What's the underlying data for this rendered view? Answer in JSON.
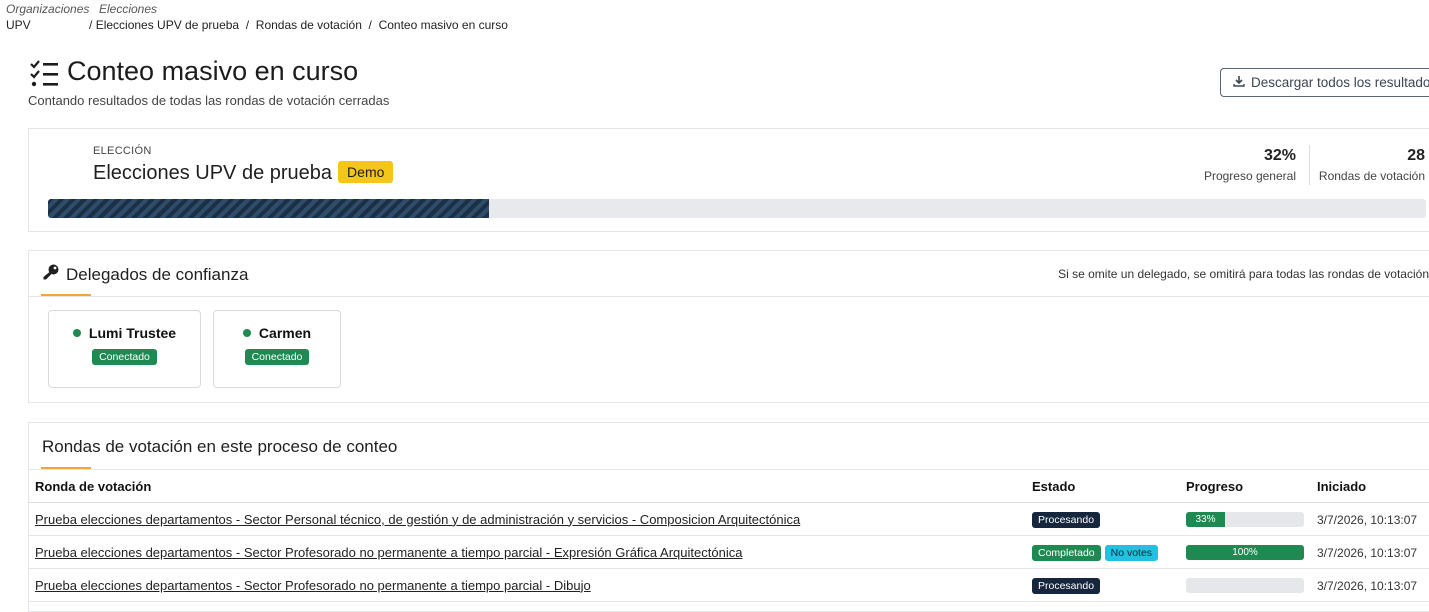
{
  "breadcrumb": {
    "org_category": "Organizaciones",
    "org_value": "UPV",
    "elections_category": "Elecciones",
    "election": "Elecciones UPV de prueba",
    "rounds": "Rondas de votación",
    "current": "Conteo masivo en curso",
    "separator": "/"
  },
  "header": {
    "icon": "checklist-icon",
    "title": "Conteo masivo en curso",
    "subtitle": "Contando resultados de todas las rondas de votación cerradas",
    "download_label": "Descargar todos los resultados"
  },
  "election": {
    "label": "ELECCIÓN",
    "name": "Elecciones UPV de prueba",
    "badge": "Demo",
    "progress_value": "32%",
    "progress_label": "Progreso general",
    "progress_fraction": 0.32,
    "rounds_value": "28",
    "rounds_label": "Rondas de votación"
  },
  "delegates": {
    "title": "Delegados de confianza",
    "note": "Si se omite un delegado, se omitirá para todas las rondas de votación",
    "items": [
      {
        "name": "Lumi Trustee",
        "status": "Conectado"
      },
      {
        "name": "Carmen",
        "status": "Conectado"
      }
    ]
  },
  "rounds": {
    "title": "Rondas de votación en este proceso de conteo",
    "columns": [
      "Ronda de votación",
      "Estado",
      "Progreso",
      "Iniciado"
    ],
    "rows": [
      {
        "name": "Prueba elecciones departamentos - Sector Personal técnico, de gestión y de administración y servicios - Composicion Arquitectónica",
        "status": "Procesando",
        "extra_badge": "",
        "progress_text": "33%",
        "progress_fraction": 0.33,
        "started": "3/7/2026, 10:13:07"
      },
      {
        "name": "Prueba elecciones departamentos - Sector Profesorado no permanente a tiempo parcial - Expresión Gráfica Arquitectónica",
        "status": "Completado",
        "extra_badge": "No votes",
        "progress_text": "100%",
        "progress_fraction": 1.0,
        "started": "3/7/2026, 10:13:07"
      },
      {
        "name": "Prueba elecciones departamentos - Sector Profesorado no permanente a tiempo parcial - Dibujo",
        "status": "Procesando",
        "extra_badge": "",
        "progress_text": "",
        "progress_fraction": 0.0,
        "started": "3/7/2026, 10:13:07"
      }
    ]
  },
  "colors": {
    "accent_underline": "#f0a43a",
    "demo_badge": "#f5c518",
    "success": "#1e8a52",
    "processing": "#16263d",
    "info": "#22c1e0"
  }
}
